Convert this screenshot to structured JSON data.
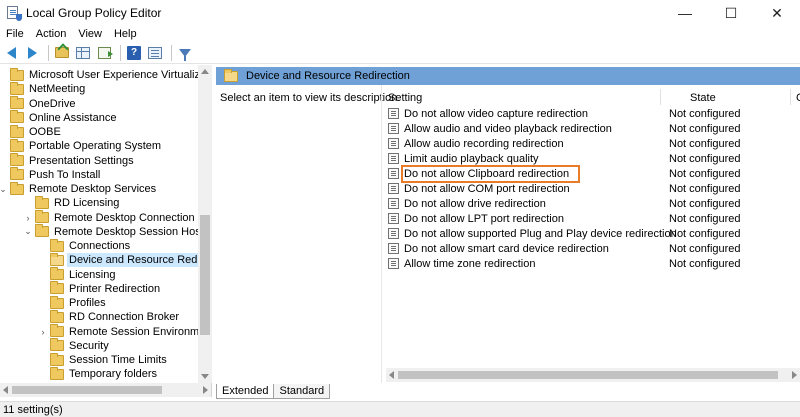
{
  "window": {
    "title": "Local Group Policy Editor",
    "minimize_glyph": "—",
    "maximize_glyph": "☐",
    "close_glyph": "✕"
  },
  "menu": [
    "File",
    "Action",
    "View",
    "Help"
  ],
  "tree": {
    "items": [
      {
        "label": "Microsoft User Experience Virtualization",
        "indent": 0,
        "expander": ""
      },
      {
        "label": "NetMeeting",
        "indent": 0,
        "expander": ""
      },
      {
        "label": "OneDrive",
        "indent": 0,
        "expander": ""
      },
      {
        "label": "Online Assistance",
        "indent": 0,
        "expander": ""
      },
      {
        "label": "OOBE",
        "indent": 0,
        "expander": ""
      },
      {
        "label": "Portable Operating System",
        "indent": 0,
        "expander": ""
      },
      {
        "label": "Presentation Settings",
        "indent": 0,
        "expander": ""
      },
      {
        "label": "Push To Install",
        "indent": 0,
        "expander": ""
      },
      {
        "label": "Remote Desktop Services",
        "indent": 0,
        "expander": "⌄"
      },
      {
        "label": "RD Licensing",
        "indent": 1,
        "expander": ""
      },
      {
        "label": "Remote Desktop Connection Client",
        "indent": 1,
        "expander": "›"
      },
      {
        "label": "Remote Desktop Session Host",
        "indent": 1,
        "expander": "⌄"
      },
      {
        "label": "Connections",
        "indent": 2,
        "expander": ""
      },
      {
        "label": "Device and Resource Redirection",
        "indent": 2,
        "expander": "",
        "selected": true
      },
      {
        "label": "Licensing",
        "indent": 2,
        "expander": ""
      },
      {
        "label": "Printer Redirection",
        "indent": 2,
        "expander": ""
      },
      {
        "label": "Profiles",
        "indent": 2,
        "expander": ""
      },
      {
        "label": "RD Connection Broker",
        "indent": 2,
        "expander": ""
      },
      {
        "label": "Remote Session Environment",
        "indent": 2,
        "expander": "›"
      },
      {
        "label": "Security",
        "indent": 2,
        "expander": ""
      },
      {
        "label": "Session Time Limits",
        "indent": 2,
        "expander": ""
      },
      {
        "label": "Temporary folders",
        "indent": 2,
        "expander": ""
      }
    ]
  },
  "details": {
    "header": "Device and Resource Redirection",
    "description": "Select an item to view its description.",
    "columns": {
      "setting": "Setting",
      "state": "State",
      "comment": "C"
    },
    "rows": [
      {
        "setting": "Do not allow video capture redirection",
        "state": "Not configured"
      },
      {
        "setting": "Allow audio and video playback redirection",
        "state": "Not configured"
      },
      {
        "setting": "Allow audio recording redirection",
        "state": "Not configured"
      },
      {
        "setting": "Limit audio playback quality",
        "state": "Not configured"
      },
      {
        "setting": "Do not allow Clipboard redirection",
        "state": "Not configured",
        "highlight": true
      },
      {
        "setting": "Do not allow COM port redirection",
        "state": "Not configured"
      },
      {
        "setting": "Do not allow drive redirection",
        "state": "Not configured"
      },
      {
        "setting": "Do not allow LPT port redirection",
        "state": "Not configured"
      },
      {
        "setting": "Do not allow supported Plug and Play device redirection",
        "state": "Not configured"
      },
      {
        "setting": "Do not allow smart card device redirection",
        "state": "Not configured"
      },
      {
        "setting": "Allow time zone redirection",
        "state": "Not configured"
      }
    ]
  },
  "tabs": [
    "Extended",
    "Standard"
  ],
  "status": "11 setting(s)",
  "colors": {
    "header_band": "#6fa0d6",
    "selection": "#cce8ff",
    "highlight_outline": "#e87c2a"
  }
}
